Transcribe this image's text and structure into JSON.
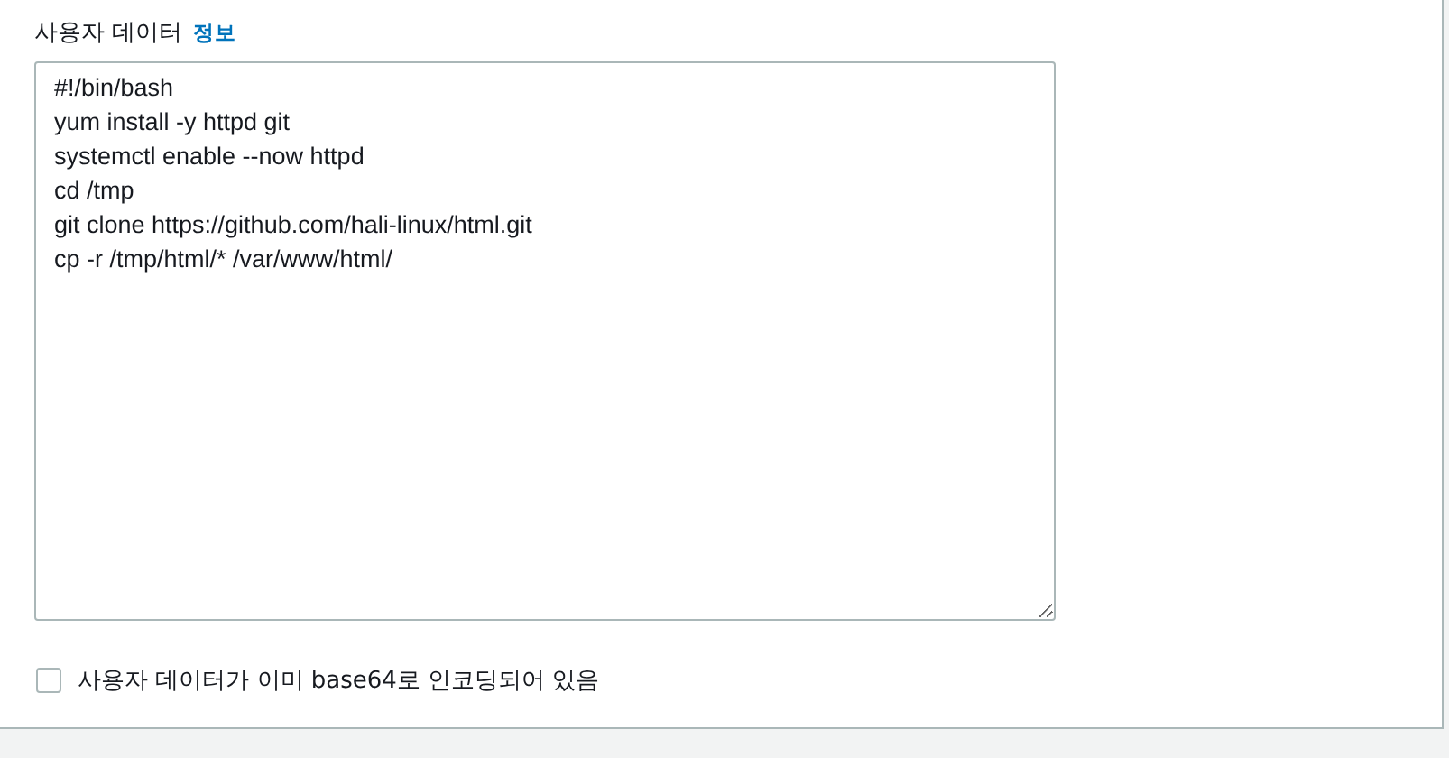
{
  "user_data": {
    "label": "사용자 데이터",
    "info_link": "정보",
    "value": "#!/bin/bash\nyum install -y httpd git\nsystemctl enable --now httpd\ncd /tmp\ngit clone https://github.com/hali-linux/html.git\ncp -r /tmp/html/* /var/www/html/"
  },
  "base64_checkbox": {
    "label": "사용자 데이터가 이미 base64로 인코딩되어 있음",
    "checked": false
  }
}
